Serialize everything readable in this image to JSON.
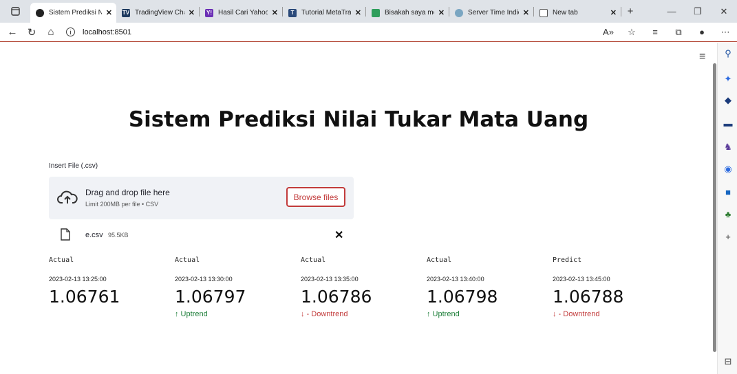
{
  "browser": {
    "tabs": [
      {
        "label": "Sistem Prediksi N",
        "color": "#222222",
        "glyph": "",
        "active": true
      },
      {
        "label": "TradingView Char",
        "color": "#1e3a5f",
        "glyph": "TV",
        "active": false
      },
      {
        "label": "Hasil Cari Yahoo",
        "color": "#6b2fb5",
        "glyph": "Y!",
        "active": false
      },
      {
        "label": "Tutorial MetaTrac",
        "color": "#2b4a7a",
        "glyph": "T",
        "active": false
      },
      {
        "label": "Bisakah saya mer",
        "color": "#2e9e5b",
        "glyph": "",
        "active": false
      },
      {
        "label": "Server Time Indic",
        "color": "#7aa6c2",
        "glyph": "",
        "active": false
      },
      {
        "label": "New tab",
        "color": "#ffffff",
        "glyph": "",
        "active": false
      }
    ],
    "url": "localhost:8501"
  },
  "app": {
    "title": "Sistem Prediksi Nilai Tukar Mata Uang",
    "upload": {
      "label": "Insert File (.csv)",
      "drag_text": "Drag and drop file here",
      "limit_text": "Limit 200MB per file • CSV",
      "browse_label": "Browse files"
    },
    "file": {
      "name": "e.csv",
      "size": "95.5KB"
    },
    "metrics": [
      {
        "label": "Actual",
        "time": "2023-02-13 13:25:00",
        "value": "1.06761",
        "delta": "",
        "trend": ""
      },
      {
        "label": "Actual",
        "time": "2023-02-13 13:30:00",
        "value": "1.06797",
        "delta": "↑ Uptrend",
        "trend": "up"
      },
      {
        "label": "Actual",
        "time": "2023-02-13 13:35:00",
        "value": "1.06786",
        "delta": "↓ - Downtrend",
        "trend": "down"
      },
      {
        "label": "Actual",
        "time": "2023-02-13 13:40:00",
        "value": "1.06798",
        "delta": "↑ Uptrend",
        "trend": "up"
      },
      {
        "label": "Predict",
        "time": "2023-02-13 13:45:00",
        "value": "1.06788",
        "delta": "↓ - Downtrend",
        "trend": "down"
      }
    ]
  }
}
